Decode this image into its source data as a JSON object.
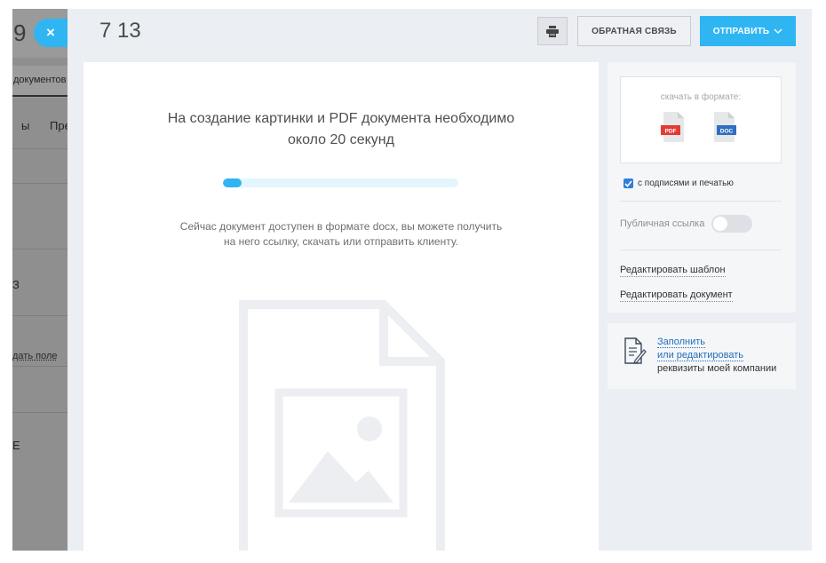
{
  "background_app": {
    "number": "9",
    "tab_label": "документов",
    "menu_items": [
      "ы",
      "Пре"
    ],
    "letter_1": "З",
    "link": "дать поле",
    "letter_2": "Е"
  },
  "modal": {
    "close_symbol": "×",
    "title": "7 13",
    "feedback_label": "ОБРАТНАЯ СВЯЗЬ",
    "send_label": "ОТПРАВИТЬ",
    "send_chevron": "∨"
  },
  "generation": {
    "message_line1": "На создание картинки и PDF документа необходимо",
    "message_line2": "около 20 секунд",
    "progress": 0.08,
    "availability_line1": "Сейчас документ доступен в формате docx, вы можете получить",
    "availability_line2": "на него ссылку, скачать или отправить клиенту."
  },
  "sidebar": {
    "download_label": "скачать в формате:",
    "formats": [
      {
        "label": "PDF",
        "color": "#e53935"
      },
      {
        "label": "DOC",
        "color": "#2f6fc1"
      }
    ],
    "signatures_checkbox": {
      "label": "с подписями и печатью",
      "checked": true
    },
    "public_link": {
      "label": "Публичная ссылка",
      "enabled": false
    },
    "edit_template": "Редактировать шаблон",
    "edit_document": "Редактировать документ"
  },
  "company": {
    "link_line1": "Заполнить",
    "link_line2": "или редактировать",
    "text": "реквизиты моей компании"
  },
  "colors": {
    "accent": "#2fb5f2",
    "panel_bg": "#ebeef3"
  }
}
